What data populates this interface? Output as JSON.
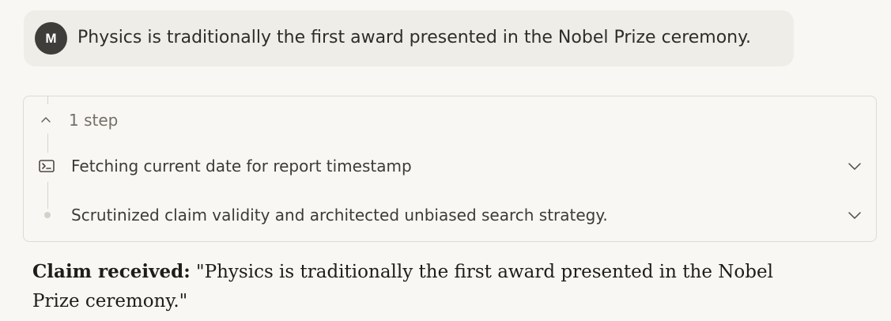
{
  "user": {
    "avatar_initial": "M",
    "message": "Physics is traditionally the first award presented in the Nobel Prize ceremony."
  },
  "steps": {
    "header": "1 step",
    "items": [
      {
        "label": "Fetching current date for report timestamp",
        "icon": "terminal-icon"
      },
      {
        "label": "Scrutinized claim validity and architected unbiased search strategy.",
        "icon": "dot-icon"
      }
    ]
  },
  "response": {
    "lead": "Claim received:",
    "text": " \"Physics is traditionally the first award presented in the Nobel Prize ceremony.\""
  },
  "colors": {
    "background": "#f8f7f3",
    "message_bubble": "#efede7",
    "avatar": "#3f3d39",
    "border": "#dedbd4",
    "muted_text": "#746f67"
  }
}
